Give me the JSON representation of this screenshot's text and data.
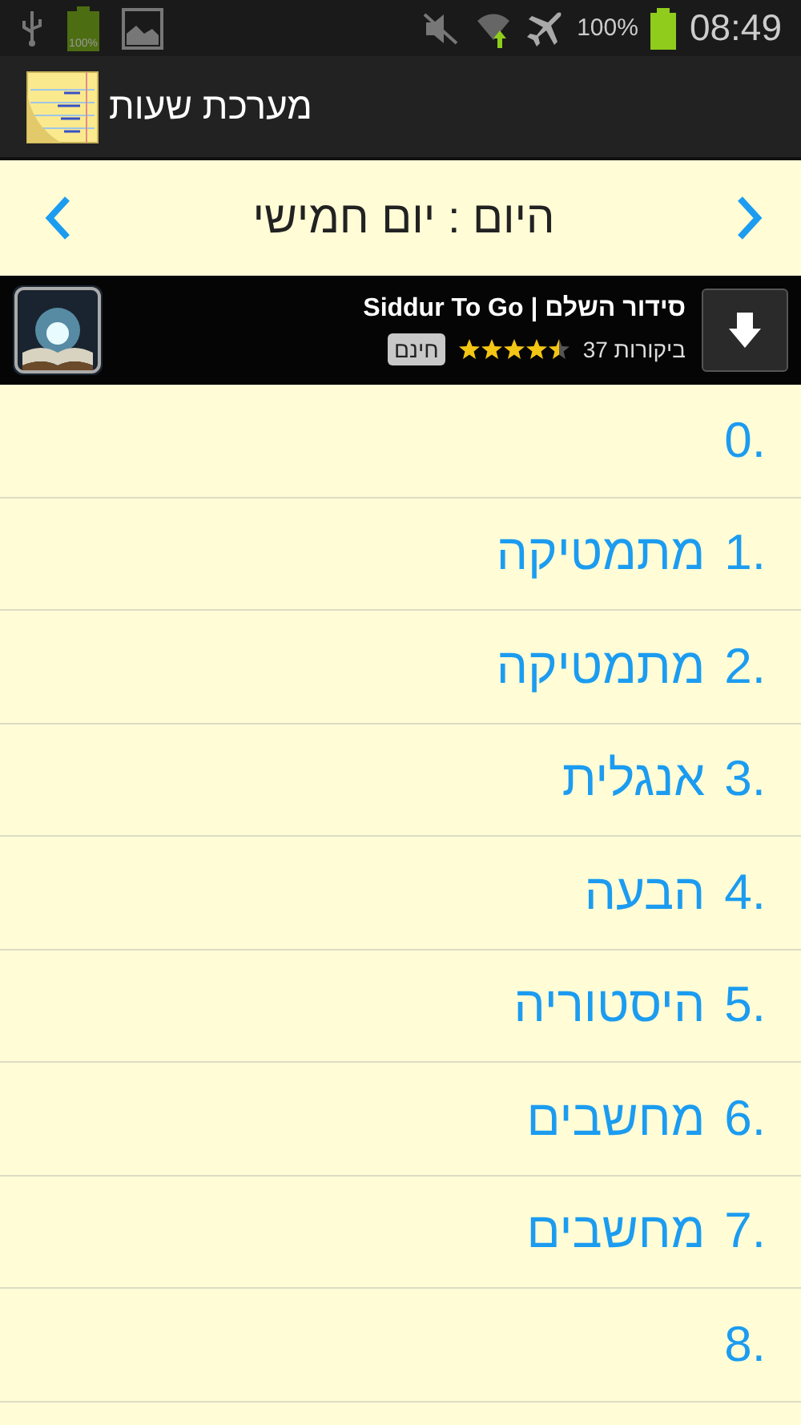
{
  "status_bar": {
    "notification_battery": "100%",
    "battery_percent": "100%",
    "time": "08:49"
  },
  "action_bar": {
    "title": "מערכת שעות"
  },
  "day_nav": {
    "title": "היום : יום חמישי"
  },
  "ad": {
    "title": "Siddur To Go | סידור השלם",
    "reviews": "ביקורות 37",
    "stars": 4.5,
    "price": "חינם"
  },
  "lessons": [
    {
      "number": "0."
    },
    {
      "number": "1.",
      "subject": "מתמטיקה"
    },
    {
      "number": "2.",
      "subject": "מתמטיקה"
    },
    {
      "number": "3.",
      "subject": "אנגלית"
    },
    {
      "number": "4.",
      "subject": "הבעה"
    },
    {
      "number": "5.",
      "subject": "היסטוריה"
    },
    {
      "number": "6.",
      "subject": "מחשבים"
    },
    {
      "number": "7.",
      "subject": "מחשבים"
    },
    {
      "number": "8."
    }
  ]
}
